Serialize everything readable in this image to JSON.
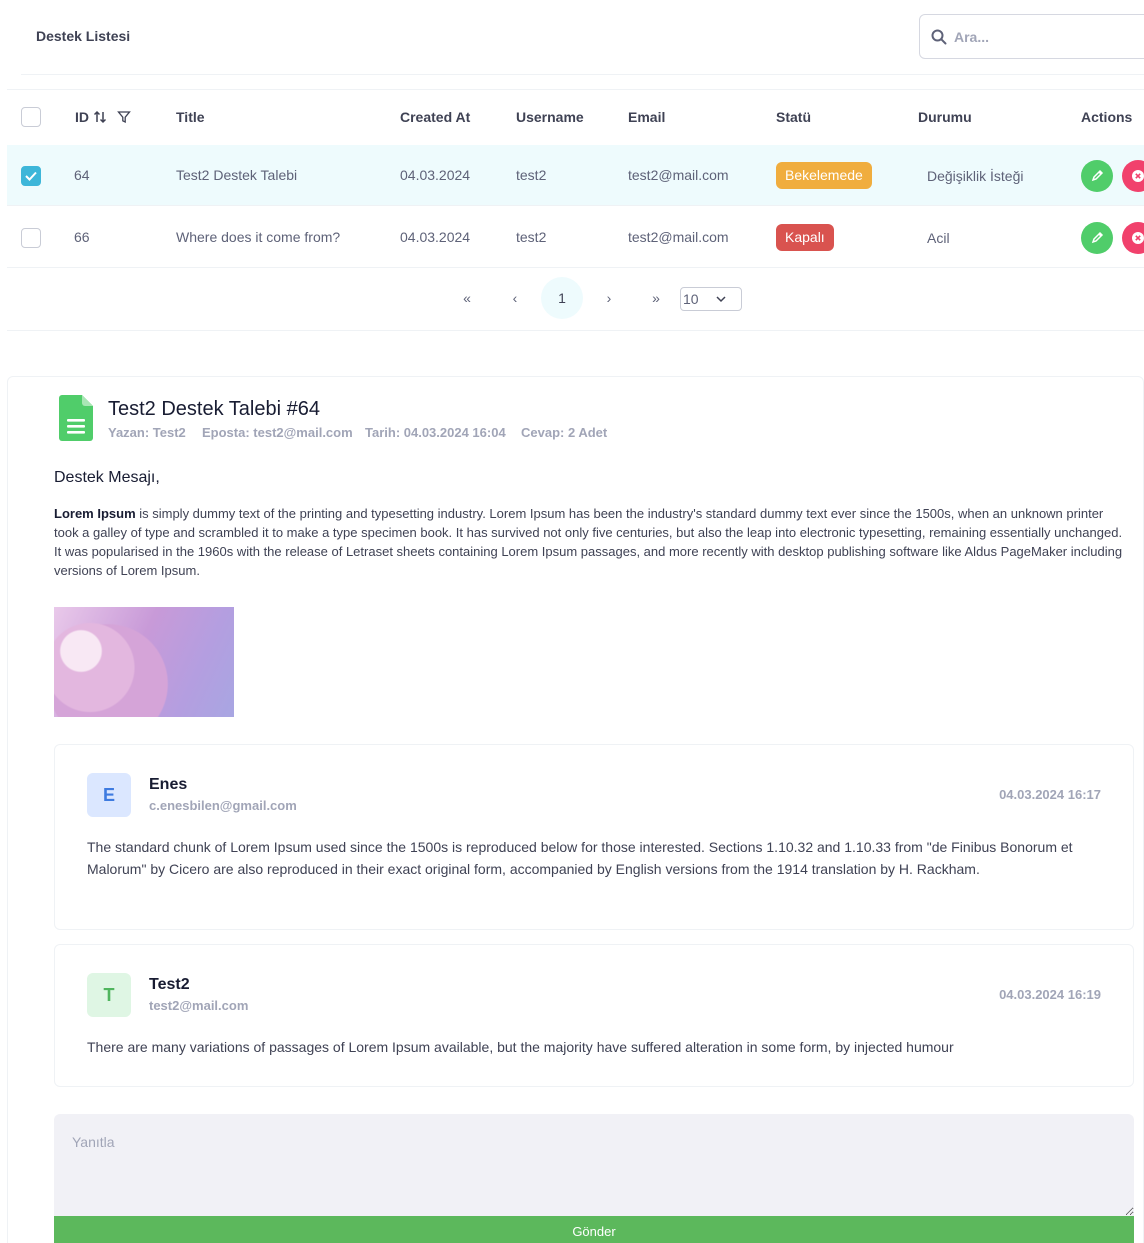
{
  "list": {
    "title": "Destek Listesi",
    "search_placeholder": "Ara...",
    "columns": [
      "ID",
      "Title",
      "Created At",
      "Username",
      "Email",
      "Statü",
      "Durumu",
      "Actions"
    ],
    "rows": [
      {
        "id": "64",
        "title": "Test2 Destek Talebi",
        "created_at": "04.03.2024",
        "username": "test2",
        "email": "test2@mail.com",
        "status": "Bekelemede",
        "status_color": "#f0ad3e",
        "durum": "Değişiklik İsteği",
        "selected": true
      },
      {
        "id": "66",
        "title": "Where does it come from?",
        "created_at": "04.03.2024",
        "username": "test2",
        "email": "test2@mail.com",
        "status": "Kapalı",
        "status_color": "#d9534f",
        "durum": "Acil",
        "selected": false
      }
    ],
    "pagination": {
      "first": "«",
      "prev": "‹",
      "current_page": "1",
      "next": "›",
      "last": "»",
      "page_size": "10"
    }
  },
  "detail": {
    "title": "Test2 Destek Talebi #64",
    "meta": {
      "author": "Yazan: Test2",
      "email": "Eposta: test2@mail.com",
      "date": "Tarih: 04.03.2024 16:04",
      "replies": "Cevap: 2 Adet"
    },
    "message_heading": "Destek Mesajı,",
    "message_bold": "Lorem Ipsum",
    "message_text": " is simply dummy text of the printing and typesetting industry. Lorem Ipsum has been the industry's standard dummy text ever since the 1500s, when an unknown printer took a galley of type and scrambled it to make a type specimen book. It has survived not only five centuries, but also the leap into electronic typesetting, remaining essentially unchanged. It was popularised in the 1960s with the release of Letraset sheets containing Lorem Ipsum passages, and more recently with desktop publishing software like Aldus PageMaker including versions of Lorem Ipsum.",
    "replies": [
      {
        "initial": "E",
        "name": "Enes",
        "email": "c.enesbilen@gmail.com",
        "date": "04.03.2024 16:17",
        "text": "The standard chunk of Lorem Ipsum used since the 1500s is reproduced below for those interested. Sections 1.10.32 and 1.10.33 from \"de Finibus Bonorum et Malorum\" by Cicero are also reproduced in their exact original form, accompanied by English versions from the 1914 translation by H. Rackham."
      },
      {
        "initial": "T",
        "name": "Test2",
        "email": "test2@mail.com",
        "date": "04.03.2024 16:19",
        "text": "There are many variations of passages of Lorem Ipsum available, but the majority have suffered alteration in some form, by injected humour"
      }
    ],
    "reply_placeholder": "Yanıtla",
    "send_label": "Gönder"
  },
  "colors": {
    "accent": "#3db6d9",
    "success": "#50cd6a",
    "danger": "#f1416c",
    "send": "#5cb85c"
  }
}
